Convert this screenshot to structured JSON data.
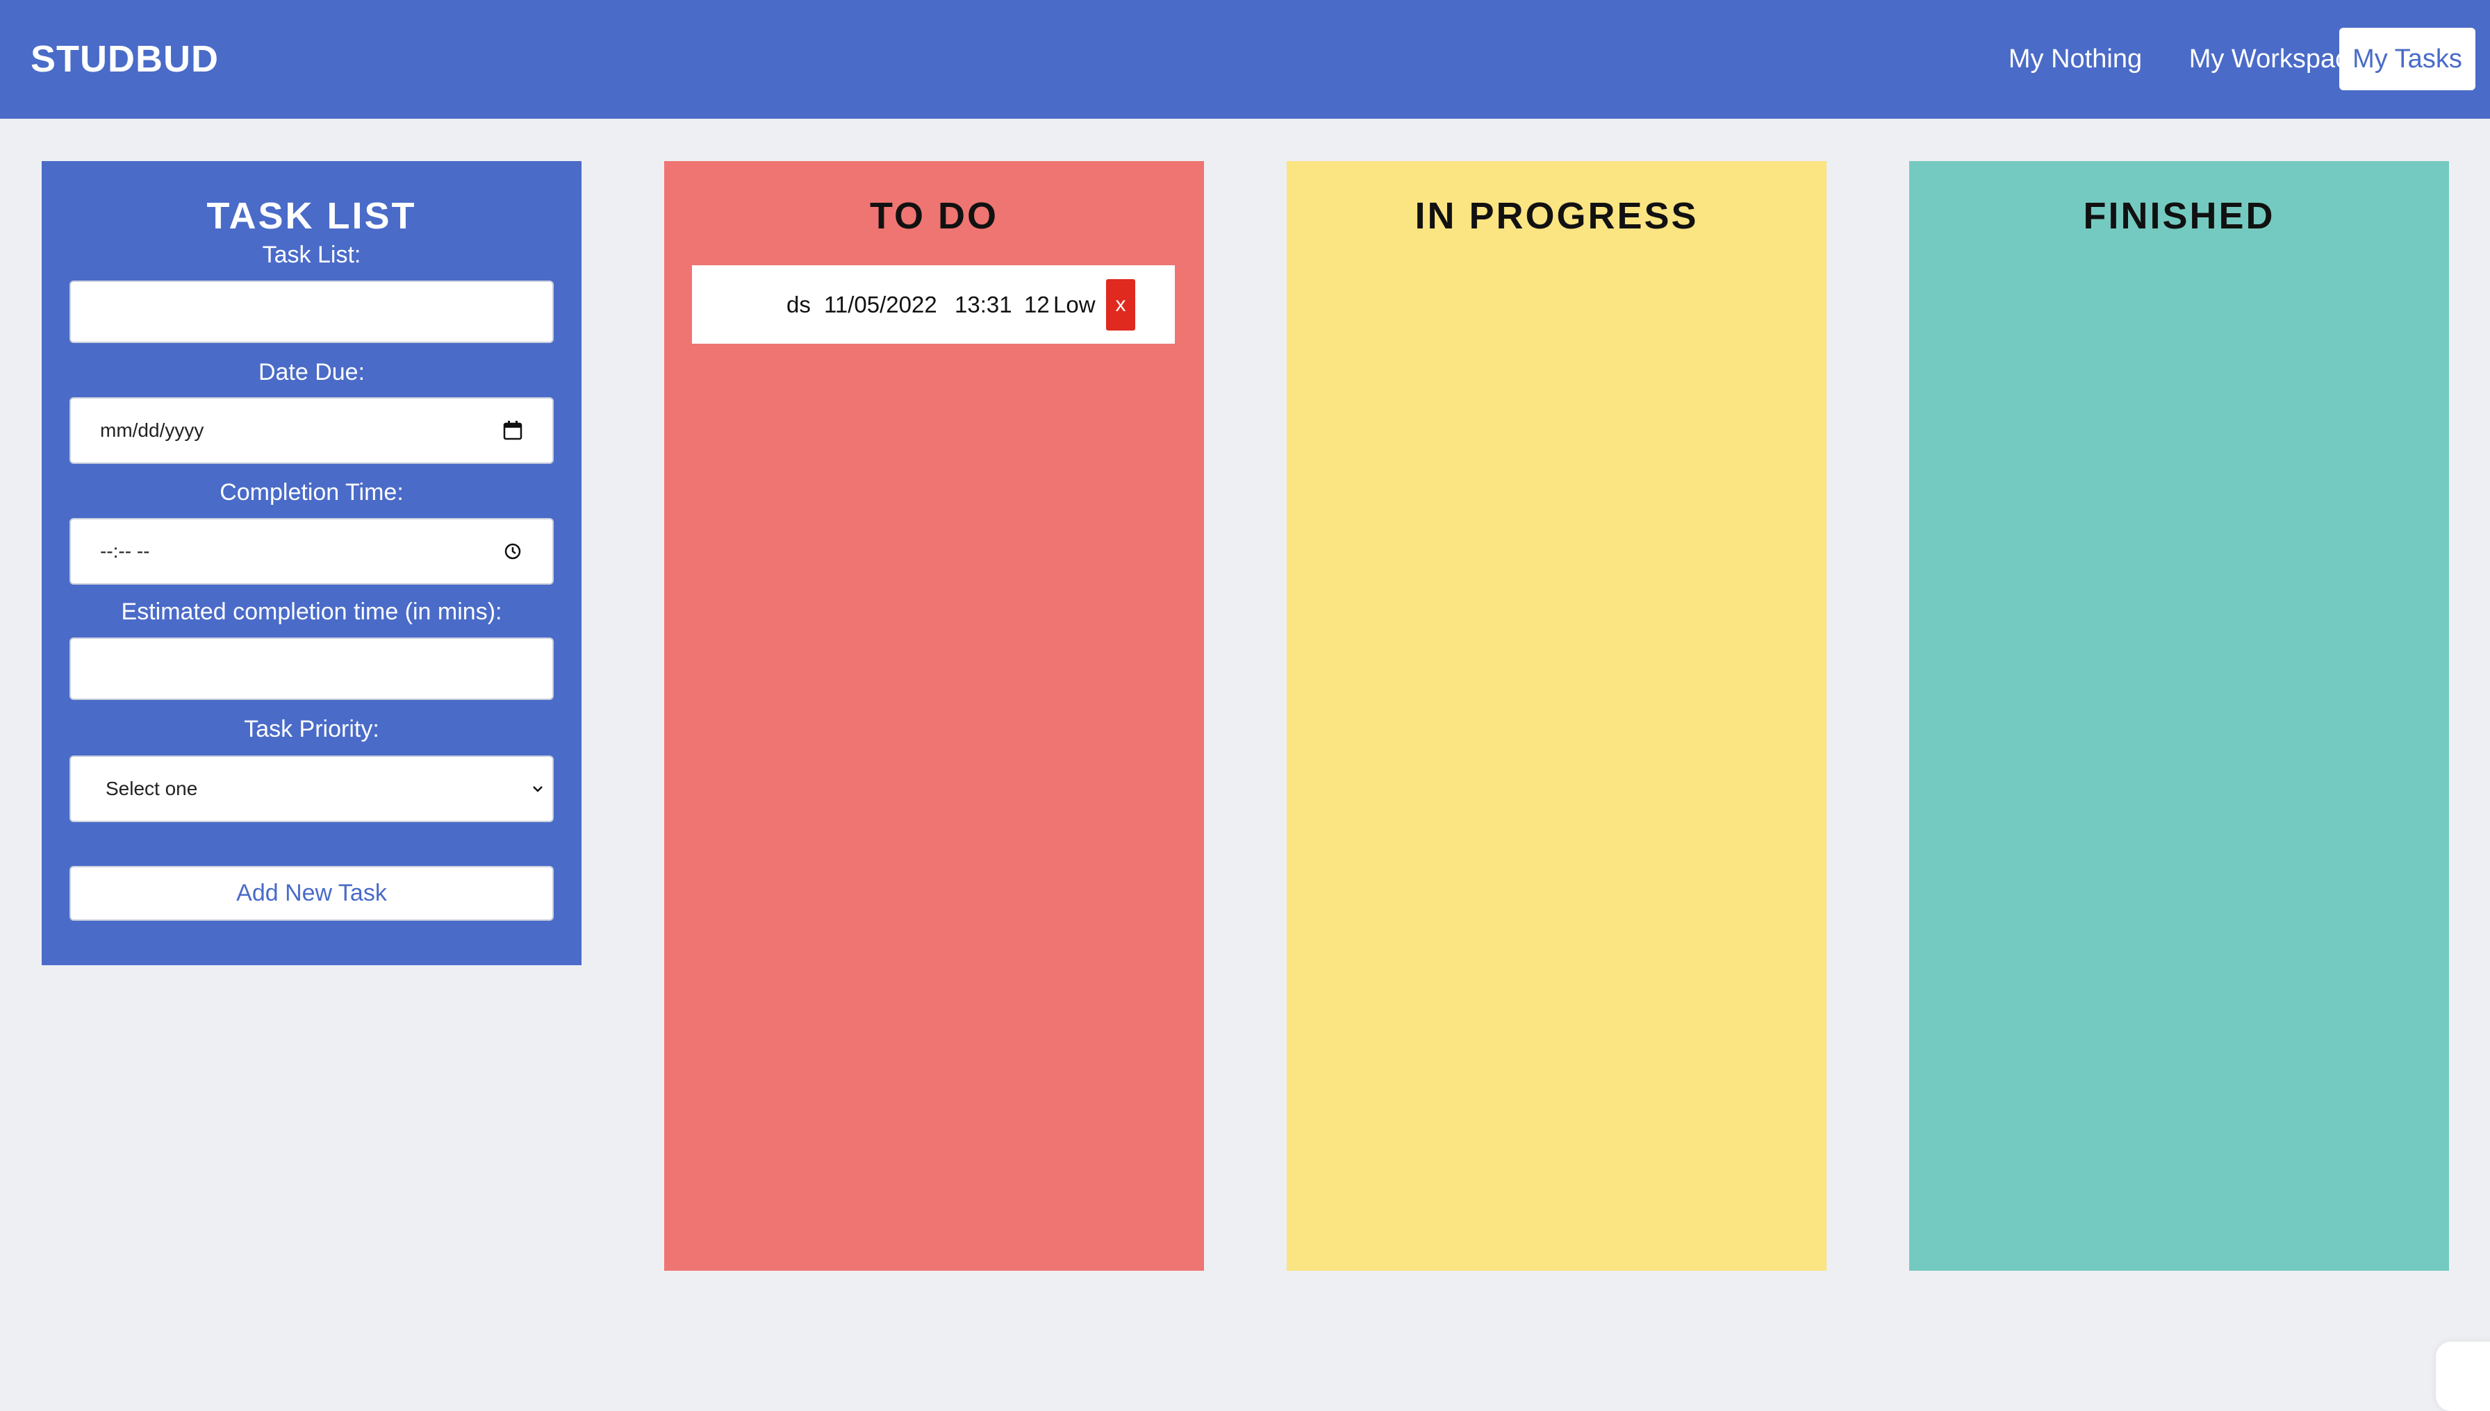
{
  "header": {
    "brand": "STUDBUD",
    "nav": {
      "nothing": "My Nothing",
      "workspace": "My Workspace",
      "tasks": "My Tasks"
    }
  },
  "form": {
    "title": "TASK LIST",
    "task_label": "Task List:",
    "task_value": "",
    "date_label": "Date Due:",
    "date_placeholder": "mm/dd/yyyy",
    "time_label": "Completion Time:",
    "time_placeholder": "--:-- --",
    "estimate_label": "Estimated completion time (in mins):",
    "estimate_value": "",
    "priority_label": "Task Priority:",
    "priority_selected": "Select one",
    "submit_label": "Add New Task"
  },
  "columns": {
    "todo": {
      "title": "TO DO",
      "tasks": [
        {
          "name": "ds",
          "date": "11/05/2022",
          "time": "13:31",
          "mins": "12",
          "priority": "Low",
          "delete_label": "x"
        }
      ]
    },
    "progress": {
      "title": "IN PROGRESS",
      "tasks": []
    },
    "finished": {
      "title": "FINISHED",
      "tasks": []
    }
  },
  "colors": {
    "header": "#4a6bc8",
    "todo": "#ee7571",
    "progress": "#fbe482",
    "finished": "#74cac0",
    "delete": "#e02a1f"
  },
  "icons": {
    "date": "calendar-icon",
    "time": "clock-icon",
    "select": "chevron-down-icon"
  }
}
